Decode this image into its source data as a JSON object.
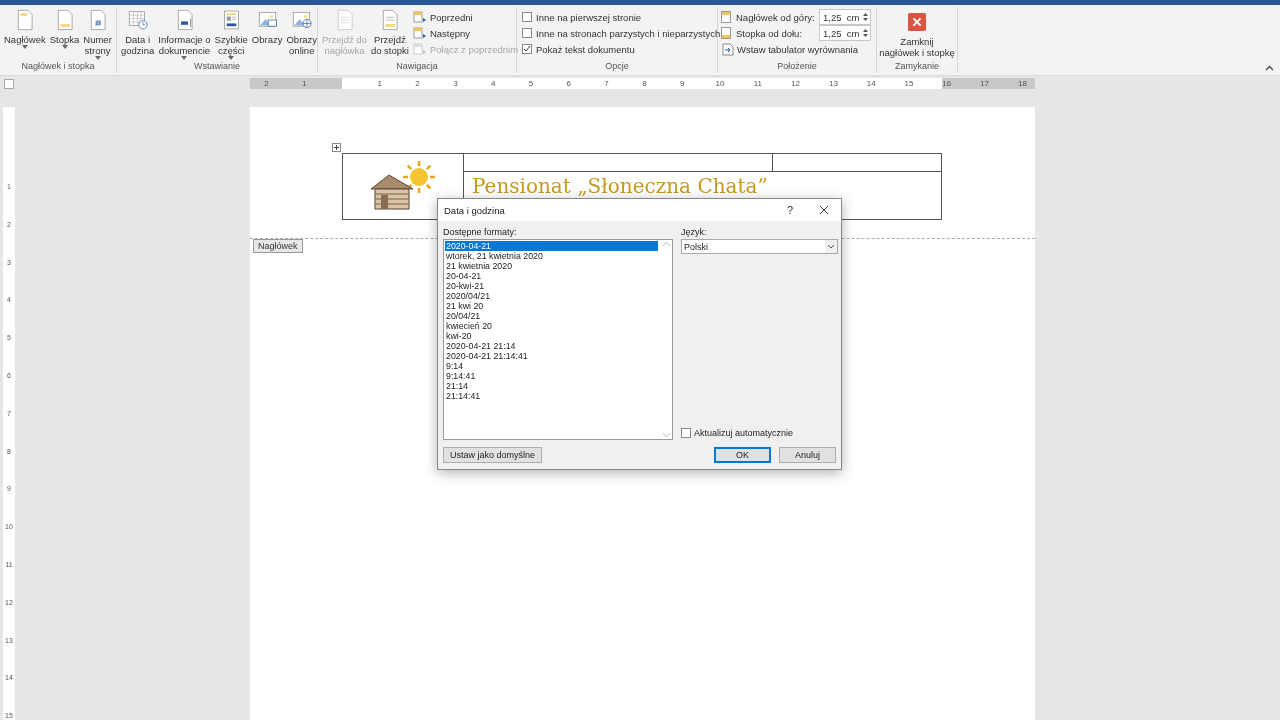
{
  "ribbon": {
    "groups": [
      {
        "label": "Nagłówek i stopka",
        "items": [
          {
            "kind": "large",
            "label": "Nagłówek",
            "dropdown": true,
            "disabled": false
          },
          {
            "kind": "large",
            "label": "Stopka",
            "dropdown": true,
            "disabled": false
          },
          {
            "kind": "large",
            "label": "Numer\nstrony",
            "dropdown": true,
            "disabled": false
          }
        ]
      },
      {
        "label": "Wstawianie",
        "items": [
          {
            "kind": "large",
            "label": "Data i\ngodzina",
            "dropdown": false,
            "disabled": false
          },
          {
            "kind": "large",
            "label": "Informacje o\ndokumencie",
            "dropdown": true,
            "disabled": false
          },
          {
            "kind": "large",
            "label": "Szybkie\nczęści",
            "dropdown": true,
            "disabled": false
          },
          {
            "kind": "large",
            "label": "Obrazy",
            "dropdown": false,
            "disabled": false
          },
          {
            "kind": "large",
            "label": "Obrazy\nonline",
            "dropdown": false,
            "disabled": false
          }
        ]
      },
      {
        "label": "Nawigacja",
        "items": [
          {
            "kind": "large",
            "label": "Przejdź do\nnagłówka",
            "dropdown": false,
            "disabled": true
          },
          {
            "kind": "large",
            "label": "Przejdź\ndo stopki",
            "dropdown": false,
            "disabled": false
          },
          {
            "kind": "stack",
            "items": [
              {
                "label": "Poprzedni",
                "disabled": false
              },
              {
                "label": "Następny",
                "disabled": false
              },
              {
                "label": "Połącz z poprzednim",
                "disabled": true
              }
            ]
          }
        ]
      },
      {
        "label": "Opcje",
        "items": [
          {
            "kind": "checks",
            "items": [
              {
                "label": "Inne na pierwszej stronie",
                "checked": false
              },
              {
                "label": "Inne na stronach parzystych i nieparzystych",
                "checked": false
              },
              {
                "label": "Pokaż tekst dokumentu",
                "checked": true
              }
            ]
          }
        ]
      },
      {
        "label": "Położenie",
        "items": [
          {
            "kind": "position",
            "spinners": [
              {
                "label": "Nagłówek od góry:",
                "value": "1,25  cm"
              },
              {
                "label": "Stopka od dołu:",
                "value": "1,25  cm"
              }
            ],
            "action": "Wstaw tabulator wyrównania"
          }
        ]
      },
      {
        "label": "Zamykanie",
        "items": [
          {
            "kind": "close",
            "label": "Zamknij\nnagłówek i stopkę",
            "dropdown": false,
            "disabled": false
          }
        ]
      }
    ]
  },
  "ruler": {
    "left_labels": [
      "2",
      "1"
    ],
    "labels": [
      "1",
      "2",
      "3",
      "4",
      "5",
      "6",
      "7",
      "8",
      "9",
      "10",
      "11",
      "12",
      "13",
      "14",
      "15",
      "16",
      "17",
      "18"
    ]
  },
  "vertical_ruler": {
    "labels": [
      "1",
      "2",
      "3",
      "4",
      "5",
      "6",
      "7",
      "8",
      "9",
      "10",
      "11",
      "12",
      "13",
      "14",
      "15"
    ]
  },
  "document": {
    "header_title": "Pensionat „Słoneczna Chata”",
    "header_tag": "Nagłówek"
  },
  "dialog": {
    "title": "Data i godzina",
    "help": "?",
    "formats_label": "Dostępne formaty:",
    "formats": [
      {
        "text": "2020-04-21",
        "selected": true
      },
      {
        "text": "wtorek, 21 kwietnia 2020",
        "selected": false
      },
      {
        "text": "21 kwietnia 2020",
        "selected": false
      },
      {
        "text": "20-04-21",
        "selected": false
      },
      {
        "text": "20-kwi-21",
        "selected": false
      },
      {
        "text": "2020/04/21",
        "selected": false
      },
      {
        "text": "21 kwi 20",
        "selected": false
      },
      {
        "text": "20/04/21",
        "selected": false
      },
      {
        "text": "kwiecień 20",
        "selected": false
      },
      {
        "text": "kwi-20",
        "selected": false
      },
      {
        "text": "2020-04-21 21:14",
        "selected": false
      },
      {
        "text": "2020-04-21 21:14:41",
        "selected": false
      },
      {
        "text": "9:14",
        "selected": false
      },
      {
        "text": "9:14:41",
        "selected": false
      },
      {
        "text": "21:14",
        "selected": false
      },
      {
        "text": "21:14:41",
        "selected": false
      }
    ],
    "language_label": "Język:",
    "language": "Polski",
    "auto_update": {
      "label": "Aktualizuj automatycznie",
      "checked": false
    },
    "buttons": [
      {
        "label": "Ustaw jako domyślne",
        "kind": "secondary"
      },
      {
        "label": "OK",
        "kind": "default"
      },
      {
        "label": "Anuluj",
        "kind": "normal"
      }
    ]
  }
}
